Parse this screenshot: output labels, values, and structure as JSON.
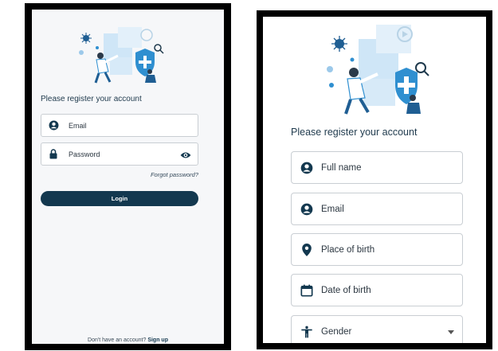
{
  "login_screen": {
    "title": "Please register your account",
    "email_placeholder": "Email",
    "password_placeholder": "Password",
    "forgot_password": "Forgot password?",
    "login_button": "Login",
    "signup_prompt": "Don't have an account?",
    "signup_link": "Sign up"
  },
  "register_screen": {
    "title": "Please register your account",
    "fields": [
      {
        "label": "Full name",
        "icon": "person-icon"
      },
      {
        "label": "Email",
        "icon": "person-icon"
      },
      {
        "label": "Place of birth",
        "icon": "location-pin-icon"
      },
      {
        "label": "Date of birth",
        "icon": "calendar-icon"
      },
      {
        "label": "Gender",
        "icon": "accessibility-icon"
      }
    ]
  },
  "colors": {
    "primary": "#13384f",
    "illustration_blue": "#2f8fd0",
    "illustration_light": "#cfe6f7"
  }
}
